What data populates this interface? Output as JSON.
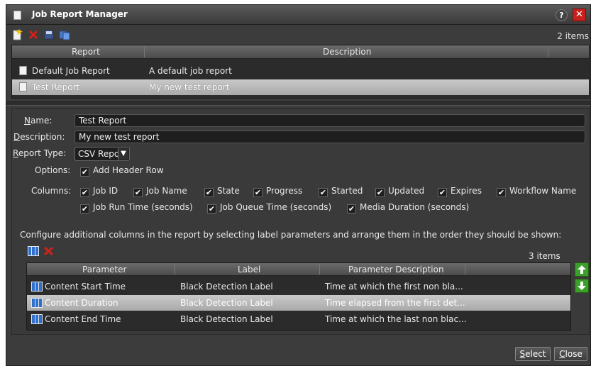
{
  "window": {
    "title": "Job Report Manager",
    "help": "?",
    "close": "✕"
  },
  "toolbar": {
    "items_count": "2 items"
  },
  "report_table": {
    "columns": [
      "Report",
      "Description"
    ],
    "rows": [
      {
        "report": "Default Job Report",
        "description": "A default job report"
      },
      {
        "report": "Test Report",
        "description": "My new test report"
      }
    ]
  },
  "form": {
    "name_label_u": "N",
    "name_label_rest": "ame:",
    "name_value": "Test Report",
    "description_label_u": "D",
    "description_label_rest": "escription:",
    "description_value": "My new test report",
    "report_type_label_u": "R",
    "report_type_label_rest": "eport Type:",
    "report_type_value": "CSV Report",
    "options_label": "Options:",
    "add_header_row": "Add Header Row",
    "columns_label": "Columns:",
    "columns": [
      "Job ID",
      "Job Name",
      "State",
      "Progress",
      "Started",
      "Updated",
      "Expires",
      "Workflow Name",
      "Job Run Time (seconds)",
      "Job Queue Time (seconds)",
      "Media Duration (seconds)"
    ],
    "configure_text": "Configure additional columns in the report by selecting label parameters and arrange them in the order they should be shown:"
  },
  "param_table": {
    "items_count": "3 items",
    "columns": [
      "Parameter",
      "Label",
      "Parameter Description"
    ],
    "rows": [
      {
        "parameter": "Content Start Time",
        "label": "Black Detection Label",
        "description": "Time at which the first non bla..."
      },
      {
        "parameter": "Content Duration",
        "label": "Black Detection Label",
        "description": "Time elapsed from the first det..."
      },
      {
        "parameter": "Content End Time",
        "label": "Black Detection Label",
        "description": "Time at which the last non blac..."
      }
    ]
  },
  "buttons": {
    "select_u": "S",
    "select_rest": "elect",
    "close_u": "C",
    "close_rest": "lose"
  },
  "colors": {
    "window_bg": "#3c3c3c",
    "selection": "#b8b8b8",
    "close_red": "#c8201c",
    "arrow_green": "#3aa02a"
  }
}
